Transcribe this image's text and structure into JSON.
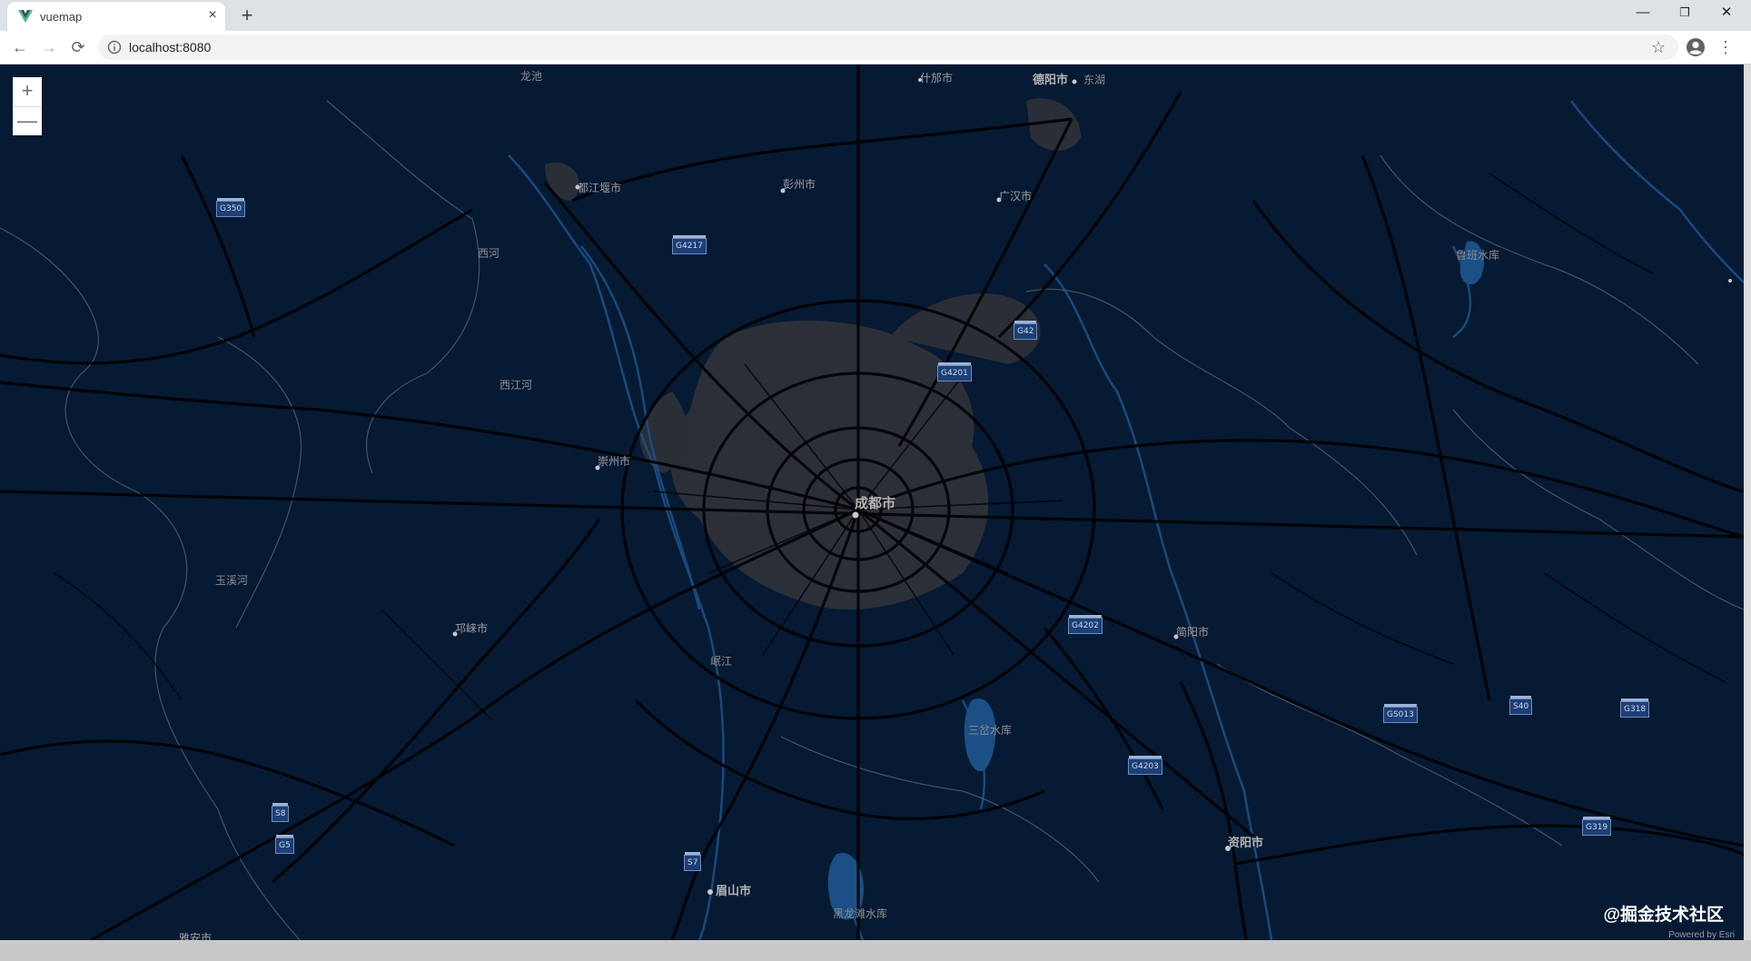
{
  "browser": {
    "tab_title": "vuemap",
    "tab_close": "×",
    "new_tab": "+",
    "url": "localhost:8080",
    "minimize": "—",
    "restore": "❐",
    "close": "✕",
    "back": "←",
    "forward": "→",
    "reload": "⟳",
    "bookmark_star": "☆",
    "menu": "⋮"
  },
  "map": {
    "zoom_in": "+",
    "zoom_out": "—",
    "watermark": "@掘金技术社区",
    "powered_by": "Powered by Esri",
    "labels": {
      "longchi": "龙池",
      "shifang": "什邡市",
      "deyang": "德阳市",
      "donghu": "东湖",
      "dujiangyan": "都江堰市",
      "pengzhou": "彭州市",
      "guanghan": "广汉市",
      "xihe": "西河",
      "lubanshuiku": "鲁班水库",
      "xijianghe": "西江河",
      "chongzhou": "崇州市",
      "chengdu": "成都市",
      "yuxihe": "玉溪河",
      "qionglai": "邛崃市",
      "minjiang": "岷江",
      "jianyang": "简阳市",
      "sanchashuiku": "三岔水库",
      "ziyang": "资阳市",
      "meishan": "眉山市",
      "heilongtan": "黑龙滩水库",
      "yaan": "雅安市"
    },
    "shields": {
      "g350": "G350",
      "g4217": "G4217",
      "g42": "G42",
      "g4201": "G4201",
      "g4202": "G4202",
      "g4203": "G4203",
      "gs013": "GS013",
      "s40": "S40",
      "g318": "G318",
      "g319": "G319",
      "s8": "S8",
      "g5": "G5",
      "s7": "S7"
    }
  }
}
